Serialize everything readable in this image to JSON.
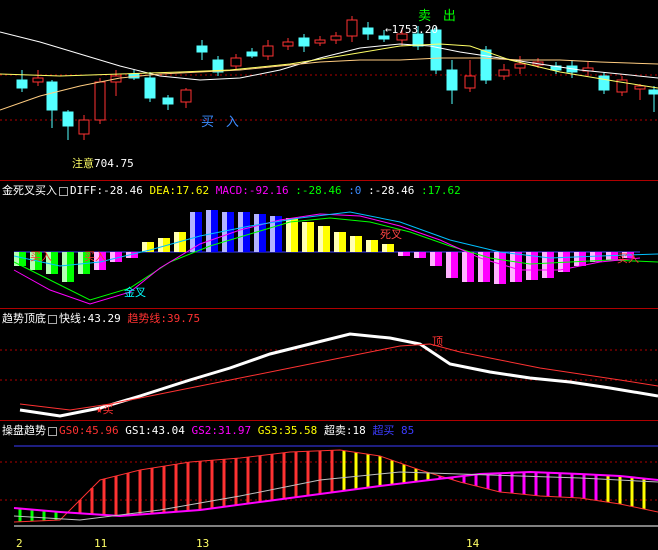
{
  "price_panel": {
    "buy_label": "买 入",
    "sell_label": "卖 出",
    "high_price": "1753.20",
    "low_price": "704.75",
    "attention_label": "注意"
  },
  "macd_panel": {
    "title": "金死叉买入",
    "diff": "DIFF:-28.46",
    "dea": "DEA:17.62",
    "macd": "MACD:-92.16",
    "v4": ":-28.46",
    "v5": ":0",
    "v6": ":-28.46",
    "v7": ":17.62",
    "gold_cross": "金叉",
    "death_cross": "死叉",
    "buy_in_1": "买入",
    "buy_in_2": "买入",
    "buy_in_3": "买入"
  },
  "trend_panel": {
    "title": "趋势顶底",
    "fast": "快线:43.29",
    "trend": "趋势线:39.75",
    "top": "顶",
    "buy": "买"
  },
  "op_panel": {
    "title": "操盘趋势",
    "gs0": "GS0:45.96",
    "gs1": "GS1:43.04",
    "gs2": "GS2:31.97",
    "gs3": "GS3:35.58",
    "overbought": "超卖:18",
    "oversold": "超买 85"
  },
  "x_axis": [
    "2",
    "11",
    "13",
    "14"
  ],
  "colors": {
    "up": "#ff3232",
    "down": "#54ffff",
    "macd_bar_pos": "#ffff00",
    "white": "#ffffff",
    "trend_line": "#ff3232",
    "magenta": "#ff00ff",
    "grid": "#b00000"
  }
}
